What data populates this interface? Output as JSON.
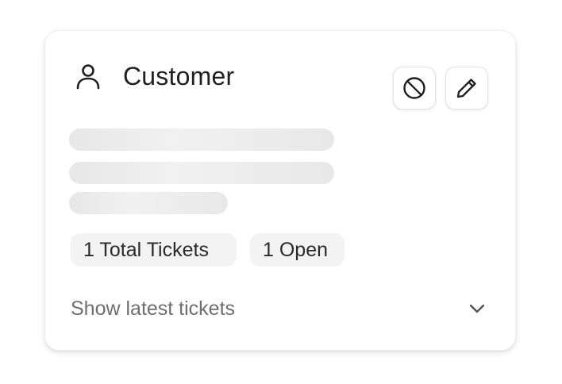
{
  "customer_card": {
    "title": "Customer",
    "icons": {
      "header": "person-icon",
      "block": "block-icon",
      "edit": "pencil-icon",
      "expand": "chevron-down-icon"
    },
    "badges": {
      "total_tickets": "1 Total Tickets",
      "open": "1 Open"
    },
    "show_latest_label": "Show latest tickets"
  }
}
